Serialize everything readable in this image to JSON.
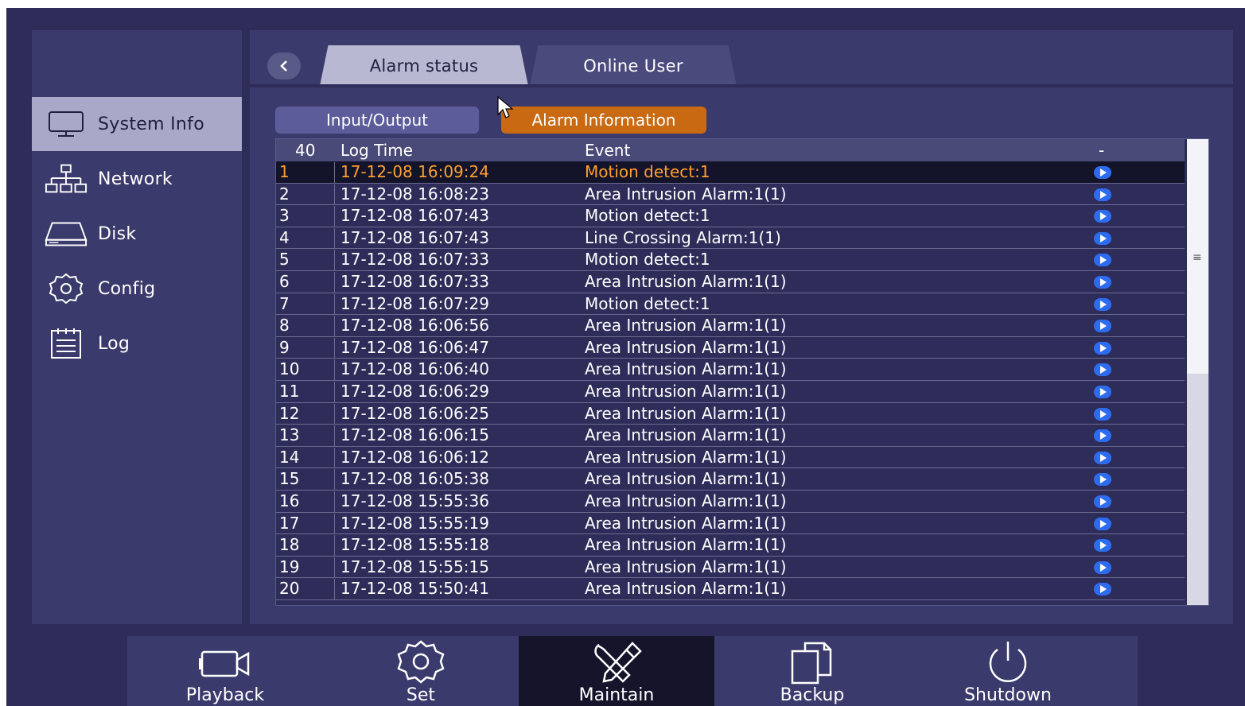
{
  "sidebar": {
    "items": [
      {
        "label": "System Info",
        "icon": "monitor-icon",
        "active": true
      },
      {
        "label": "Network",
        "icon": "network-icon",
        "active": false
      },
      {
        "label": "Disk",
        "icon": "disk-icon",
        "active": false
      },
      {
        "label": "Config",
        "icon": "gear-icon",
        "active": false
      },
      {
        "label": "Log",
        "icon": "log-icon",
        "active": false
      }
    ]
  },
  "tabs": [
    {
      "label": "Alarm status",
      "active": true
    },
    {
      "label": "Online User",
      "active": false
    }
  ],
  "subtabs": [
    {
      "label": "Input/Output",
      "active": false
    },
    {
      "label": "Alarm Information",
      "active": true
    }
  ],
  "table": {
    "count": "40",
    "headers": {
      "time": "Log Time",
      "event": "Event",
      "play": "-"
    },
    "rows": [
      {
        "idx": "1",
        "time": "17-12-08 16:09:24",
        "event": "Motion detect:1"
      },
      {
        "idx": "2",
        "time": "17-12-08 16:08:23",
        "event": "Area Intrusion Alarm:1(1)"
      },
      {
        "idx": "3",
        "time": "17-12-08 16:07:43",
        "event": "Motion detect:1"
      },
      {
        "idx": "4",
        "time": "17-12-08 16:07:43",
        "event": "Line Crossing Alarm:1(1)"
      },
      {
        "idx": "5",
        "time": "17-12-08 16:07:33",
        "event": "Motion detect:1"
      },
      {
        "idx": "6",
        "time": "17-12-08 16:07:33",
        "event": "Area Intrusion Alarm:1(1)"
      },
      {
        "idx": "7",
        "time": "17-12-08 16:07:29",
        "event": "Motion detect:1"
      },
      {
        "idx": "8",
        "time": "17-12-08 16:06:56",
        "event": "Area Intrusion Alarm:1(1)"
      },
      {
        "idx": "9",
        "time": "17-12-08 16:06:47",
        "event": "Area Intrusion Alarm:1(1)"
      },
      {
        "idx": "10",
        "time": "17-12-08 16:06:40",
        "event": "Area Intrusion Alarm:1(1)"
      },
      {
        "idx": "11",
        "time": "17-12-08 16:06:29",
        "event": "Area Intrusion Alarm:1(1)"
      },
      {
        "idx": "12",
        "time": "17-12-08 16:06:25",
        "event": "Area Intrusion Alarm:1(1)"
      },
      {
        "idx": "13",
        "time": "17-12-08 16:06:15",
        "event": "Area Intrusion Alarm:1(1)"
      },
      {
        "idx": "14",
        "time": "17-12-08 16:06:12",
        "event": "Area Intrusion Alarm:1(1)"
      },
      {
        "idx": "15",
        "time": "17-12-08 16:05:38",
        "event": "Area Intrusion Alarm:1(1)"
      },
      {
        "idx": "16",
        "time": "17-12-08 15:55:36",
        "event": "Area Intrusion Alarm:1(1)"
      },
      {
        "idx": "17",
        "time": "17-12-08 15:55:19",
        "event": "Area Intrusion Alarm:1(1)"
      },
      {
        "idx": "18",
        "time": "17-12-08 15:55:18",
        "event": "Area Intrusion Alarm:1(1)"
      },
      {
        "idx": "19",
        "time": "17-12-08 15:55:15",
        "event": "Area Intrusion Alarm:1(1)"
      },
      {
        "idx": "20",
        "time": "17-12-08 15:50:41",
        "event": "Area Intrusion Alarm:1(1)"
      }
    ],
    "selected_row": 1
  },
  "bottombar": [
    {
      "label": "Playback",
      "icon": "camera-icon",
      "active": false
    },
    {
      "label": "Set",
      "icon": "gear-icon",
      "active": false
    },
    {
      "label": "Maintain",
      "icon": "tools-icon",
      "active": true
    },
    {
      "label": "Backup",
      "icon": "copy-icon",
      "active": false
    },
    {
      "label": "Shutdown",
      "icon": "power-icon",
      "active": false
    }
  ],
  "colors": {
    "background": "#2e2c58",
    "panel": "#3b3a6c",
    "accent_orange": "#c96a12",
    "selected_text": "#ff9f2e",
    "play_blue": "#2d6cf0"
  }
}
